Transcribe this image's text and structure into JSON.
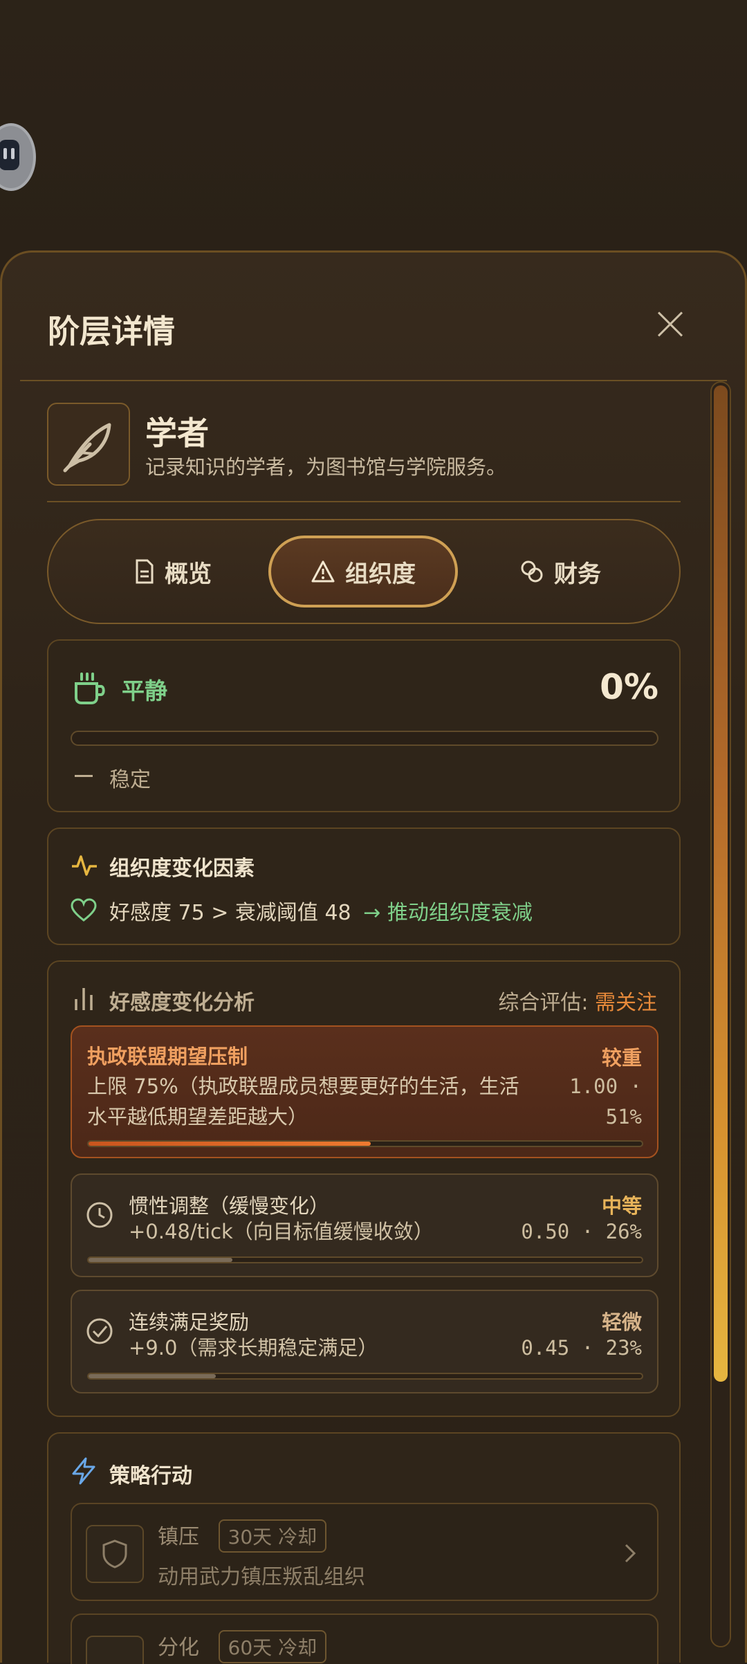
{
  "panel": {
    "title": "阶层详情"
  },
  "role": {
    "name": "学者",
    "description": "记录知识的学者，为图书馆与学院服务。"
  },
  "tabs": [
    {
      "label": "概览",
      "icon": "document-icon",
      "active": false
    },
    {
      "label": "组织度",
      "icon": "warning-triangle-icon",
      "active": true
    },
    {
      "label": "财务",
      "icon": "coins-icon",
      "active": false
    }
  ],
  "status": {
    "label": "平静",
    "percent": "0%",
    "progress": 0,
    "trend": "稳定",
    "color": "#7fd08a"
  },
  "factors": {
    "title": "组织度变化因素",
    "text": "好感度 75 > 衰减阈值 48",
    "result": "→ 推动组织度衰减"
  },
  "analysis": {
    "title": "好感度变化分析",
    "eval_label": "综合评估:",
    "eval_value": "需关注",
    "items": [
      {
        "name": "执政联盟期望压制",
        "sub1": "上限 75%（执政联盟成员想要更好的生活，生活",
        "sub2": "水平越低期望差距越大）",
        "level": "较重",
        "num1": "1.00 ·",
        "num2": "51%",
        "share": 0.51
      },
      {
        "name": "惯性调整（缓慢变化）",
        "sub1": "+0.48/tick（向目标值缓慢收敛）",
        "level": "中等",
        "num": "0.50 · 26%",
        "share": 0.26
      },
      {
        "name": "连续满足奖励",
        "sub1": "+9.0（需求长期稳定满足）",
        "level": "轻微",
        "num": "0.45 · 23%",
        "share": 0.23
      }
    ]
  },
  "actions": {
    "title": "策略行动",
    "items": [
      {
        "name": "镇压",
        "cooldown": "30天 冷却",
        "desc": "动用武力镇压叛乱组织"
      },
      {
        "name": "分化",
        "cooldown": "60天 冷却"
      }
    ]
  }
}
